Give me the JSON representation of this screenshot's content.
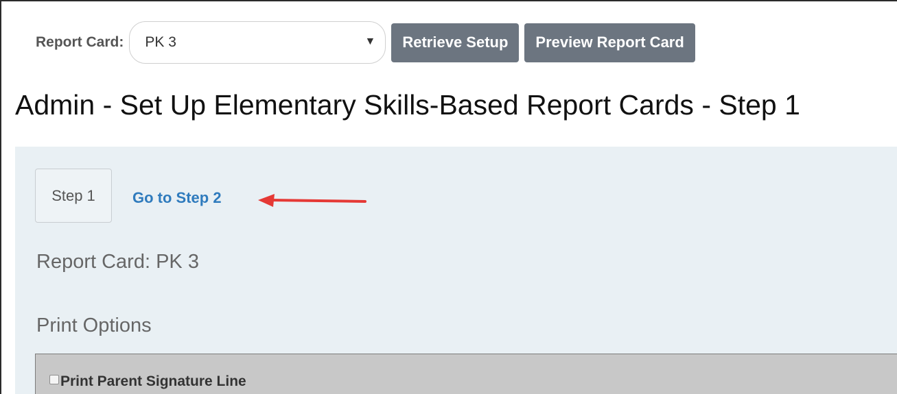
{
  "toolbar": {
    "label": "Report Card:",
    "select_value": "PK 3",
    "select_arrow": "▼",
    "retrieve_label": "Retrieve Setup",
    "preview_label": "Preview Report Card"
  },
  "page": {
    "title": "Admin - Set Up Elementary Skills-Based Report Cards - Step 1"
  },
  "steps": {
    "current": "Step 1",
    "next_link": "Go to Step 2"
  },
  "annotation": {
    "icon": "arrow-left-icon",
    "color": "#e53935"
  },
  "report_card": {
    "label": "Report Card: PK 3"
  },
  "print_options": {
    "heading": "Print Options",
    "items": [
      {
        "label": "Print Parent Signature Line",
        "checked": false
      }
    ]
  },
  "colors": {
    "button_bg": "#6c7580",
    "link": "#2f7bbd",
    "content_bg": "#e9f0f4",
    "panel_bg": "#c8c8c8"
  }
}
